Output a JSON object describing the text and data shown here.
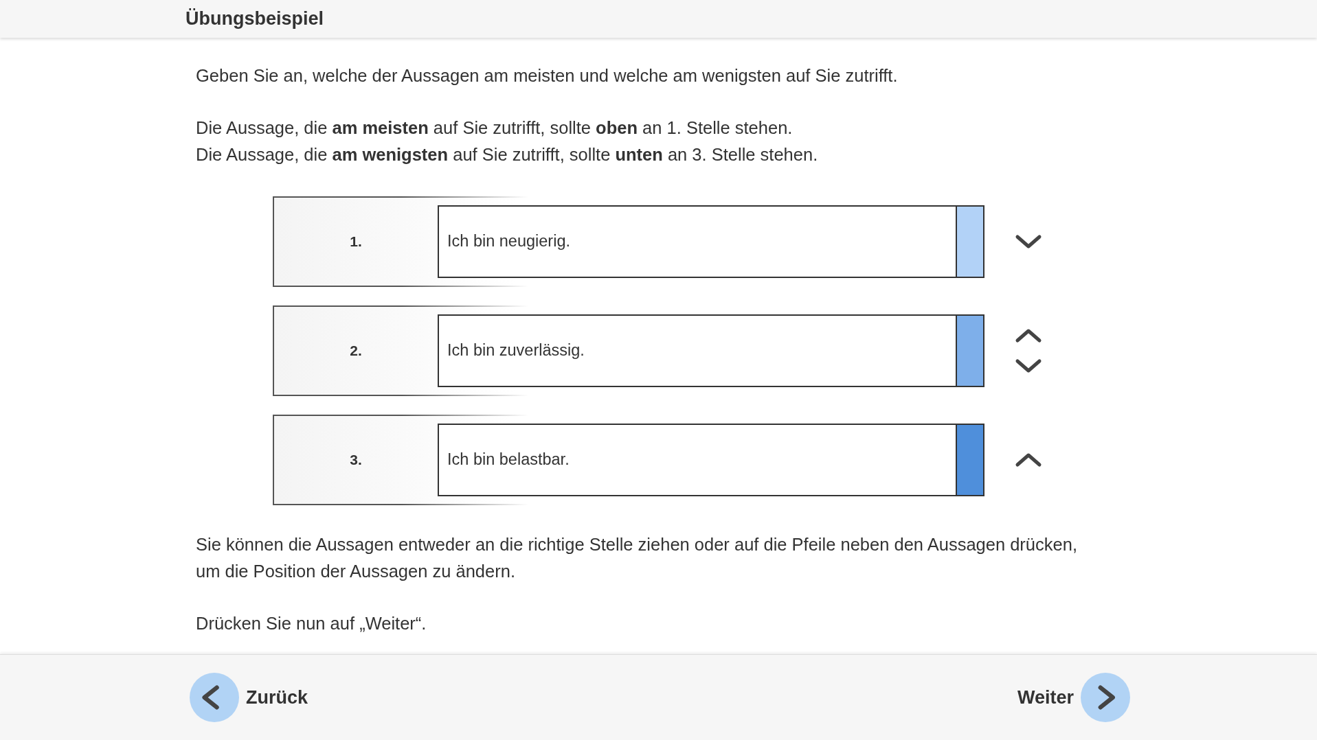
{
  "header": {
    "title": "Übungsbeispiel"
  },
  "instructions": [
    "Geben Sie an, welche der Aussagen am meisten und welche am wenigsten auf Sie zutrifft.",
    "Die Aussage, die **am meisten** auf Sie zutrifft, sollte **oben** an 1. Stelle stehen.\nDie Aussage, die **am wenigsten** auf Sie zutrifft, sollte **unten** an 3. Stelle stehen."
  ],
  "ranking": [
    {
      "rank": "1.",
      "statement": "Ich bin neugierig.",
      "color": "#b2d2f7",
      "up": false,
      "down": true
    },
    {
      "rank": "2.",
      "statement": "Ich bin zuverlässig.",
      "color": "#7eafea",
      "up": true,
      "down": true
    },
    {
      "rank": "3.",
      "statement": "Ich bin belastbar.",
      "color": "#4f8fdb",
      "up": true,
      "down": false
    }
  ],
  "notes": [
    "Sie können die Aussagen entweder an die richtige Stelle ziehen oder auf die Pfeile neben den Aussagen drücken, um die Position der Aussagen zu ändern.",
    "Drücken Sie nun auf „Weiter“."
  ],
  "footer": {
    "back": "Zurück",
    "next": "Weiter"
  }
}
